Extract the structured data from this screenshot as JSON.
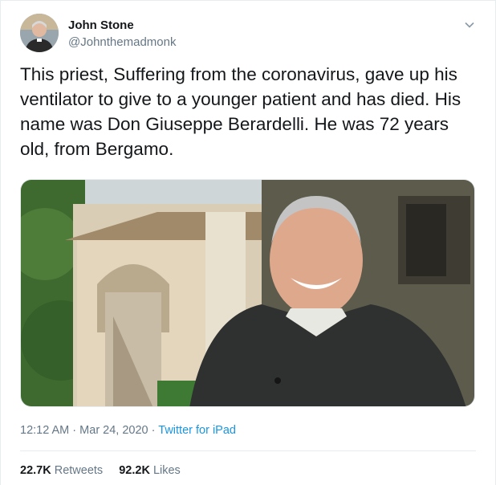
{
  "user": {
    "display_name": "John Stone",
    "handle": "@Johnthemadmonk"
  },
  "tweet": {
    "text": "This priest, Suffering from the coronavirus, gave up his ventilator to give to a younger patient and has died. His name was Don Giuseppe Berardelli. He was 72 years old, from Bergamo."
  },
  "meta": {
    "time": "12:12 AM",
    "date": "Mar 24, 2020",
    "separator": "·",
    "source": "Twitter for iPad"
  },
  "stats": {
    "retweets_count": "22.7K",
    "retweets_label": "Retweets",
    "likes_count": "92.2K",
    "likes_label": "Likes"
  },
  "icons": {
    "menu": "chevron-down-icon"
  },
  "colors": {
    "link": "#1b95e0",
    "secondary": "#657786",
    "border": "#e6ecf0"
  }
}
